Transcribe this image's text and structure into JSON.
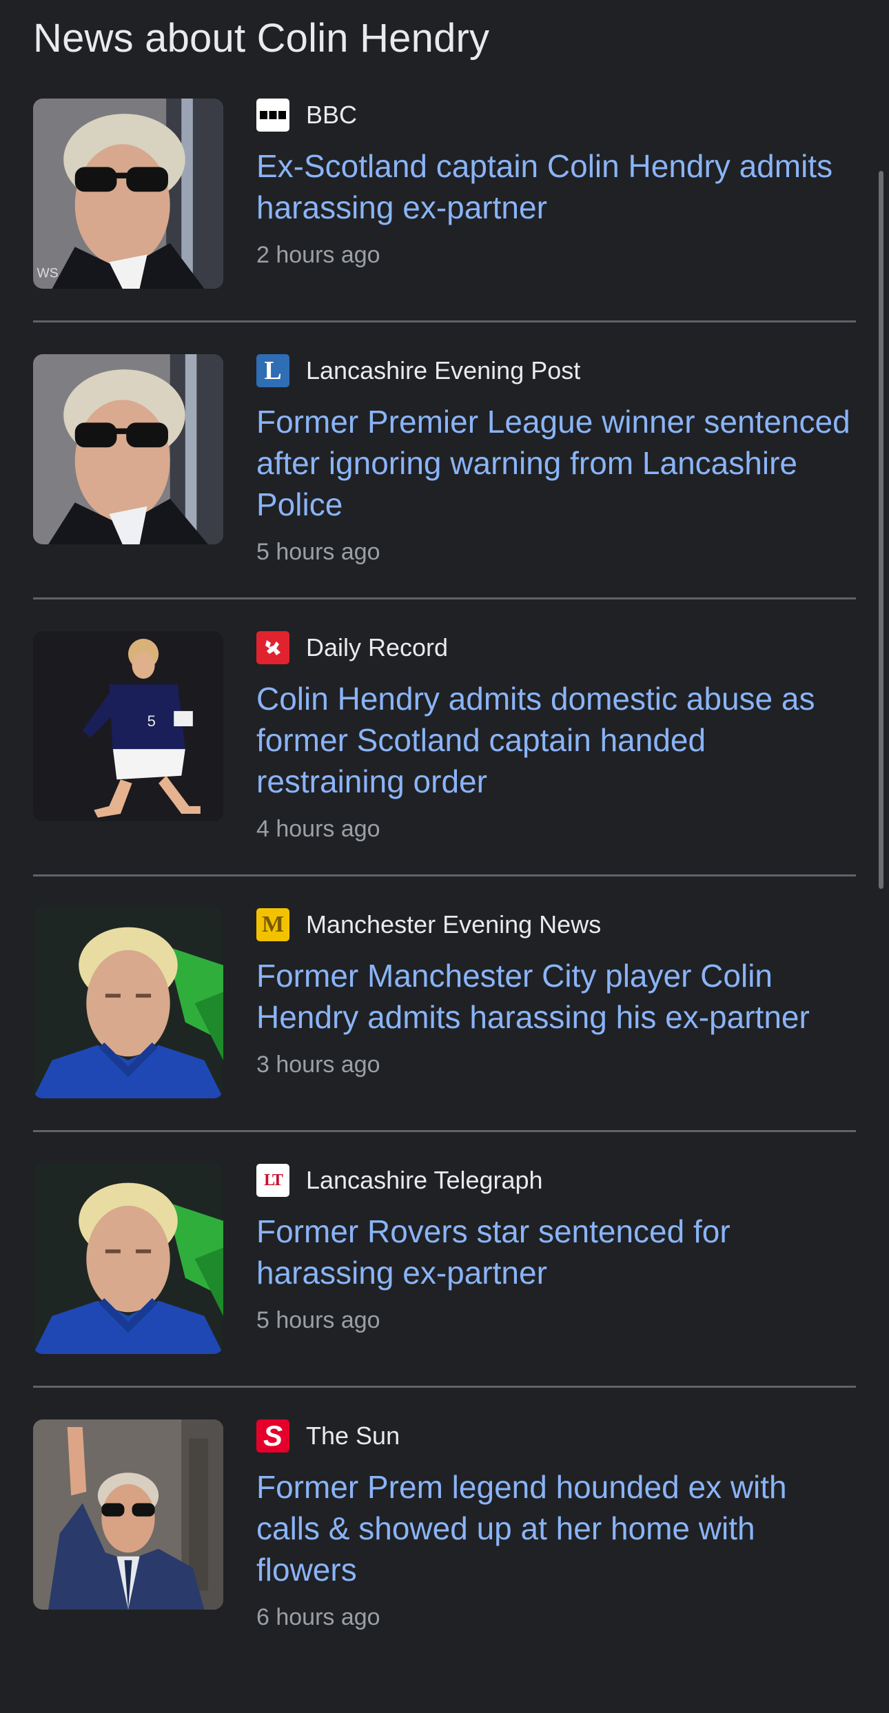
{
  "page": {
    "title": "News about Colin Hendry"
  },
  "articles": [
    {
      "source": "BBC",
      "logo": {
        "icon": "bbc-logo-icon",
        "bg": "#ffffff",
        "fg": "#000000"
      },
      "headline": "Ex-Scotland captain Colin Hendry admits harassing ex-partner",
      "time": "2 hours ago",
      "thumb": "man-sunglasses-photo"
    },
    {
      "source": "Lancashire Evening Post",
      "logo": {
        "icon": "lep-logo-icon",
        "glyph": "L",
        "bg": "#2f6db5",
        "fg": "#ffffff"
      },
      "headline": "Former Premier League winner sentenced after ignoring warning from Lancashire Police",
      "time": "5 hours ago",
      "thumb": "man-sunglasses-photo"
    },
    {
      "source": "Daily Record",
      "logo": {
        "icon": "daily-record-logo-icon",
        "bg": "#e0232f",
        "fg": "#ffffff"
      },
      "headline": "Colin Hendry admits domestic abuse as former Scotland captain handed restraining order",
      "time": "4 hours ago",
      "thumb": "footballer-action-photo"
    },
    {
      "source": "Manchester Evening News",
      "logo": {
        "icon": "men-logo-icon",
        "glyph": "M",
        "bg": "#f2c200",
        "fg": "#7a5a00"
      },
      "headline": "Former Manchester City player Colin Hendry admits harassing his ex-partner",
      "time": "3 hours ago",
      "thumb": "man-blue-shirt-photo"
    },
    {
      "source": "Lancashire Telegraph",
      "logo": {
        "icon": "lt-logo-icon",
        "glyph": "LT",
        "bg": "#ffffff",
        "fg": "#c8102e"
      },
      "headline": "Former Rovers star sentenced for harassing ex-partner",
      "time": "5 hours ago",
      "thumb": "man-blue-shirt-photo"
    },
    {
      "source": "The Sun",
      "logo": {
        "icon": "the-sun-logo-icon",
        "glyph": "S",
        "bg": "#e4002b",
        "fg": "#ffffff"
      },
      "headline": "Former Prem legend hounded ex with calls & showed up at her home with flowers",
      "time": "6 hours ago",
      "thumb": "man-pointing-photo"
    }
  ]
}
